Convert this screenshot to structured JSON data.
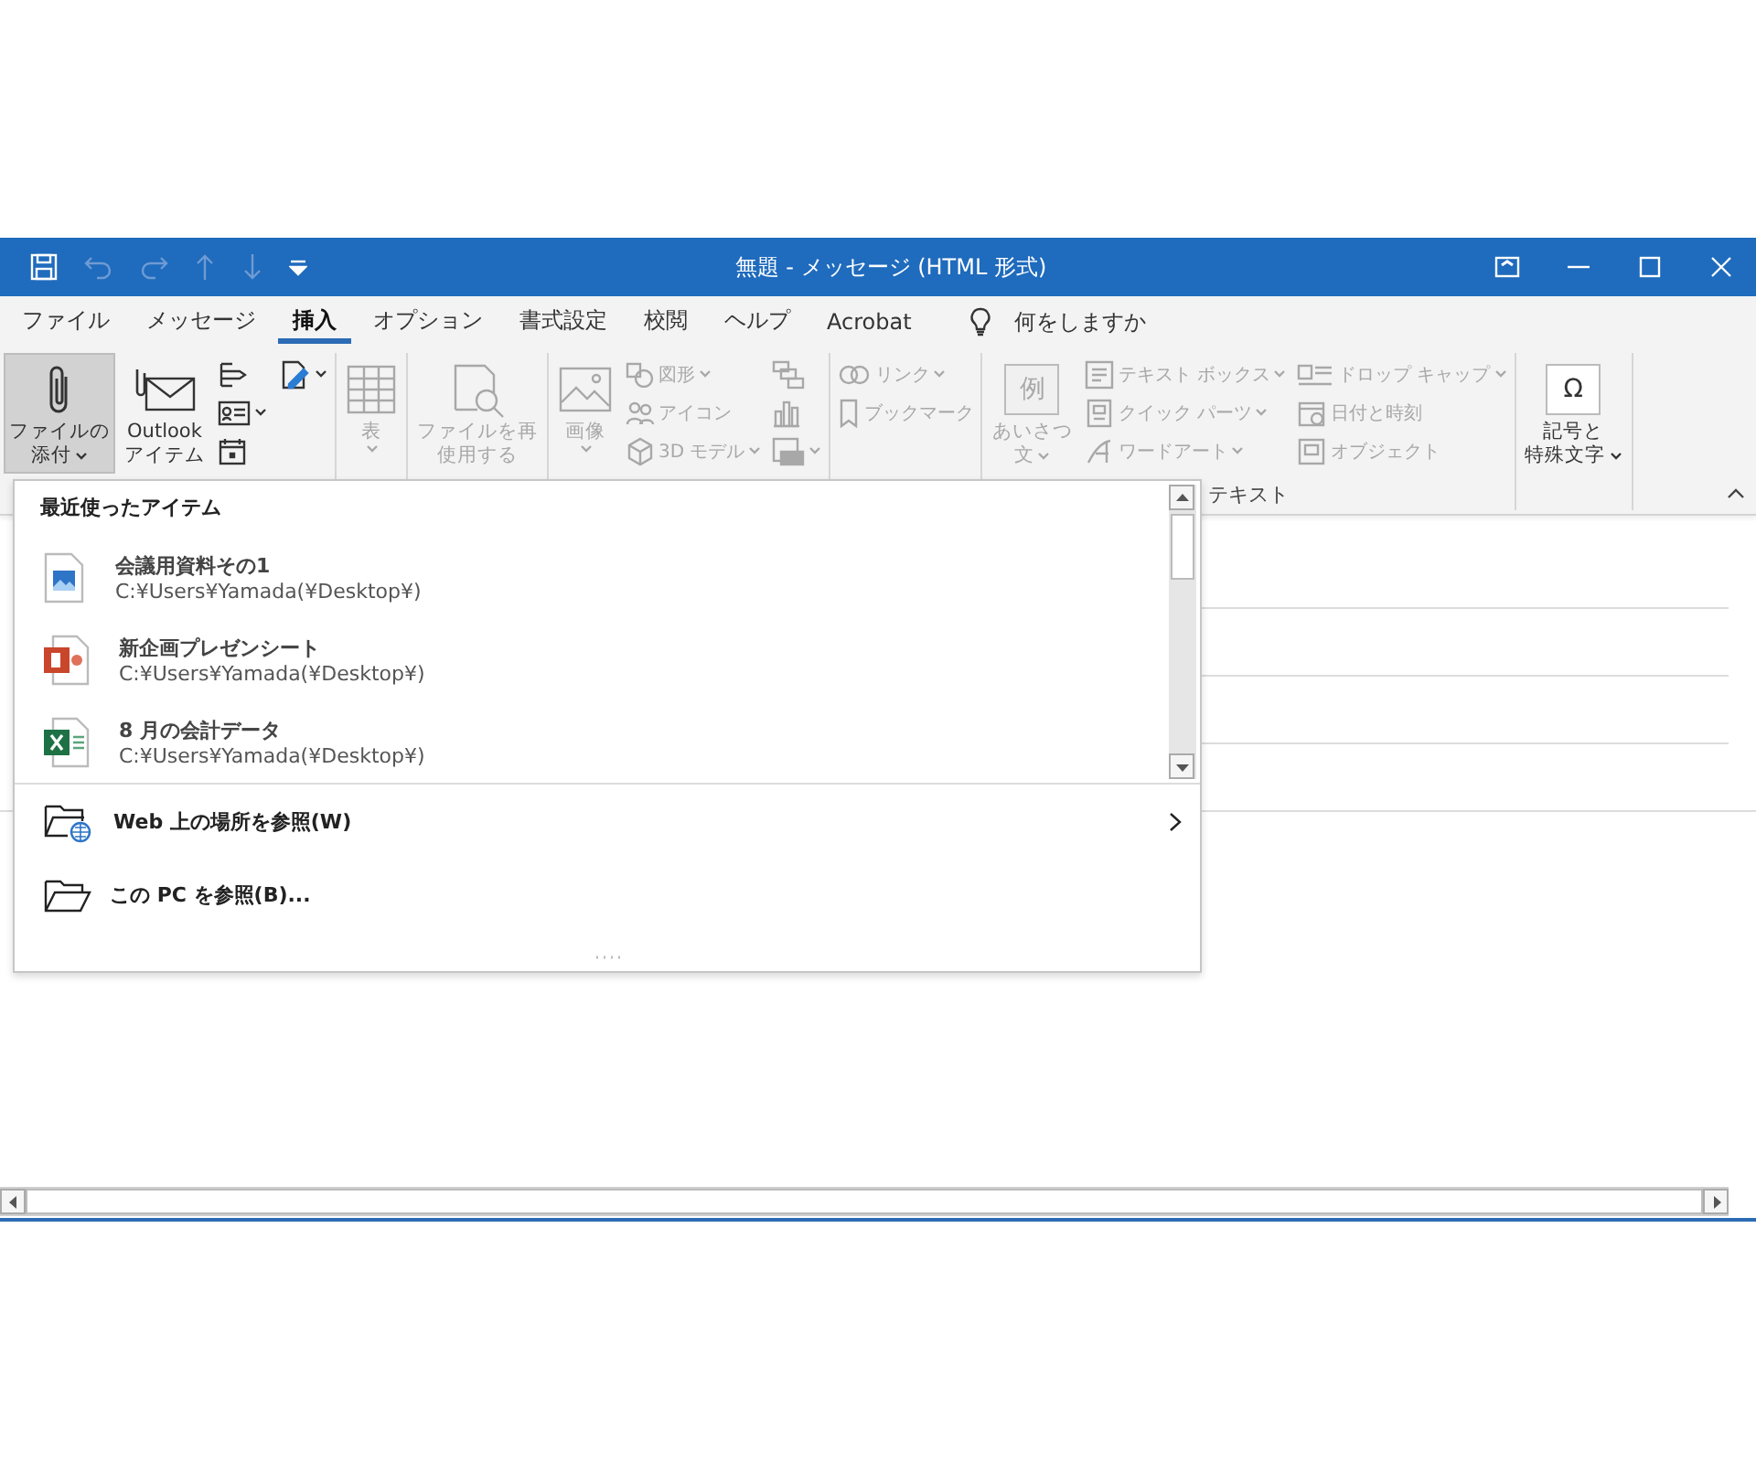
{
  "window": {
    "title": "無題 - メッセージ (HTML 形式)"
  },
  "quick_access": [
    {
      "kind": "save",
      "disabled": false
    },
    {
      "kind": "undo",
      "disabled": true
    },
    {
      "kind": "redo",
      "disabled": true
    },
    {
      "kind": "up",
      "disabled": true
    },
    {
      "kind": "down",
      "disabled": true
    },
    {
      "kind": "customize",
      "disabled": false
    }
  ],
  "tabs": [
    {
      "label": "ファイル",
      "selected": false
    },
    {
      "label": "メッセージ",
      "selected": false
    },
    {
      "label": "挿入",
      "selected": true
    },
    {
      "label": "オプション",
      "selected": false
    },
    {
      "label": "書式設定",
      "selected": false
    },
    {
      "label": "校閲",
      "selected": false
    },
    {
      "label": "ヘルプ",
      "selected": false
    },
    {
      "label": "Acrobat",
      "selected": false
    }
  ],
  "tell_me": {
    "placeholder": "何をしますか"
  },
  "ribbon": {
    "groups": [
      {
        "columns": [
          {
            "kind": "large",
            "lines": [
              "ファイルの",
              "添付"
            ],
            "dropdown": true,
            "disabled": false,
            "selected": true
          },
          {
            "kind": "large",
            "lines": [
              "Outlook",
              "アイテム"
            ],
            "dropdown": false,
            "disabled": false,
            "selected": false
          },
          {
            "kind": "stack",
            "items": [
              {
                "dropdown": false,
                "disabled": false
              },
              {
                "dropdown": true,
                "disabled": false
              },
              {
                "dropdown": false,
                "disabled": false
              }
            ]
          },
          {
            "kind": "stack",
            "items": [
              {
                "dropdown": true,
                "disabled": false
              }
            ]
          }
        ]
      },
      {
        "columns": [
          {
            "kind": "large",
            "lines": [
              "表"
            ],
            "dropdown": true,
            "disabled": true,
            "selected": false
          }
        ]
      },
      {
        "columns": [
          {
            "kind": "large",
            "lines": [
              "ファイルを再",
              "使用する"
            ],
            "dropdown": false,
            "disabled": true,
            "selected": false
          }
        ]
      },
      {
        "columns": [
          {
            "kind": "large",
            "lines": [
              "画像"
            ],
            "dropdown": true,
            "disabled": true,
            "selected": false
          },
          {
            "kind": "stack",
            "items": [
              {
                "label": "図形",
                "dropdown": true,
                "disabled": true
              },
              {
                "label": "アイコン",
                "dropdown": false,
                "disabled": true
              },
              {
                "label": "3D モデル",
                "dropdown": true,
                "disabled": true
              }
            ]
          },
          {
            "kind": "stack",
            "items": [
              {
                "dropdown": false,
                "disabled": true
              },
              {
                "dropdown": false,
                "disabled": true
              },
              {
                "dropdown": true,
                "disabled": true
              }
            ]
          }
        ]
      },
      {
        "columns": [
          {
            "kind": "stack",
            "items": [
              {
                "label": "リンク",
                "dropdown": true,
                "disabled": true
              },
              {
                "label": "ブックマーク",
                "dropdown": false,
                "disabled": true
              }
            ]
          }
        ]
      },
      {
        "label": "テキスト",
        "columns": [
          {
            "kind": "large",
            "glyph": "例",
            "lines": [
              "あいさつ",
              "文"
            ],
            "dropdown": true,
            "disabled": true,
            "selected": false
          },
          {
            "kind": "stack",
            "items": [
              {
                "label": "テキスト ボックス",
                "dropdown": true,
                "disabled": true
              },
              {
                "label": "クイック パーツ",
                "dropdown": true,
                "disabled": true
              },
              {
                "label": "ワードアート",
                "dropdown": true,
                "disabled": true
              }
            ]
          },
          {
            "kind": "stack",
            "items": [
              {
                "label": "ドロップ キャップ",
                "dropdown": true,
                "disabled": true
              },
              {
                "label": "日付と時刻",
                "dropdown": false,
                "disabled": true
              },
              {
                "label": "オブジェクト",
                "dropdown": false,
                "disabled": true
              }
            ]
          }
        ]
      },
      {
        "columns": [
          {
            "kind": "large",
            "glyph": "Ω",
            "lines": [
              "記号と",
              "特殊文字"
            ],
            "dropdown": true,
            "disabled": false,
            "selected": false
          }
        ]
      }
    ]
  },
  "attach_menu": {
    "heading": "最近使ったアイテム",
    "recent_items": [
      {
        "kind": "image",
        "name": "会議用資料その1",
        "path": "C:¥Users¥Yamada(¥Desktop¥)"
      },
      {
        "kind": "slides",
        "name": "新企画プレゼンシート",
        "path": "C:¥Users¥Yamada(¥Desktop¥)"
      },
      {
        "kind": "spreadsheet",
        "name": "8 月の会計データ",
        "path": "C:¥Users¥Yamada(¥Desktop¥)"
      }
    ],
    "actions": [
      {
        "kind": "web",
        "label": "Web 上の場所を参照(W)",
        "submenu": true
      },
      {
        "kind": "folder",
        "label": "この PC を参照(B)...",
        "submenu": false
      }
    ]
  }
}
